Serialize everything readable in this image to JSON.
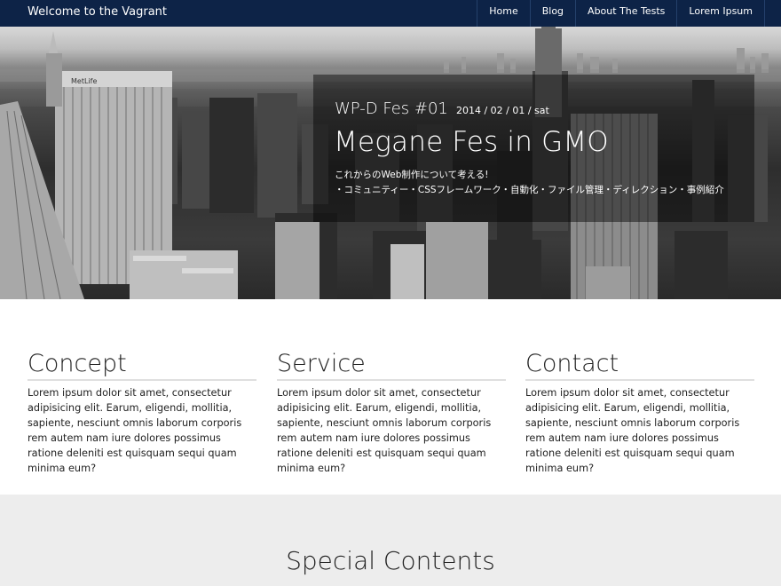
{
  "navbar": {
    "brand": "Welcome to the Vagrant",
    "items": [
      {
        "label": "Home"
      },
      {
        "label": "Blog"
      },
      {
        "label": "About The Tests"
      },
      {
        "label": "Lorem Ipsum"
      }
    ]
  },
  "hero": {
    "event_name": "WP-D Fes #01",
    "event_date": "2014 / 02 / 01 / sat",
    "title": "Megane Fes in GMO",
    "subtitle_line1": "これからのWeb制作について考える!",
    "subtitle_line2": "・コミュニティー・CSSフレームワーク・自動化・ファイル管理・ディレクション・事例紹介",
    "sign_text": "MetLife"
  },
  "features": [
    {
      "heading": "Concept",
      "body": "Lorem ipsum dolor sit amet, consectetur adipisicing elit. Earum, eligendi, mollitia, sapiente, nesciunt omnis laborum corporis rem autem nam iure dolores possimus ratione deleniti est quisquam sequi quam minima eum?"
    },
    {
      "heading": "Service",
      "body": "Lorem ipsum dolor sit amet, consectetur adipisicing elit. Earum, eligendi, mollitia, sapiente, nesciunt omnis laborum corporis rem autem nam iure dolores possimus ratione deleniti est quisquam sequi quam minima eum?"
    },
    {
      "heading": "Contact",
      "body": "Lorem ipsum dolor sit amet, consectetur adipisicing elit. Earum, eligendi, mollitia, sapiente, nesciunt omnis laborum corporis rem autem nam iure dolores possimus ratione deleniti est quisquam sequi quam minima eum?"
    }
  ],
  "special": {
    "heading": "Special Contents"
  },
  "colors": {
    "navbar": "#0d2347",
    "special_bg": "#ededed",
    "text": "#222222"
  }
}
